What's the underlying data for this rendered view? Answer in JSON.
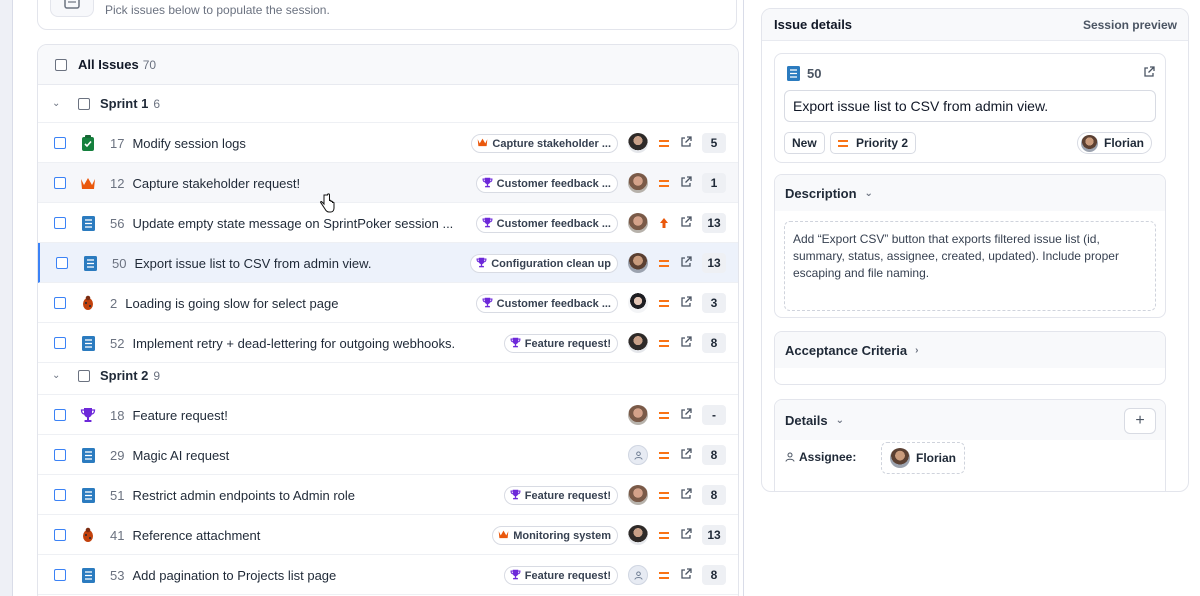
{
  "hint": {
    "text": "Pick issues below to populate the session."
  },
  "issues": {
    "all_label": "All Issues",
    "all_count": "70",
    "sprints": [
      {
        "label": "Sprint 1",
        "count": "6"
      },
      {
        "label": "Sprint 2",
        "count": "9"
      }
    ],
    "rows": [
      {
        "id": "17",
        "title": "Modify session logs",
        "type": "task-done",
        "epic": "Capture stakeholder ...",
        "epic_icon": "crown-icon",
        "avatar": "f3",
        "priority": "medium",
        "points": "5"
      },
      {
        "id": "12",
        "title": "Capture stakeholder request!",
        "type": "crown",
        "epic": "Customer feedback ...",
        "epic_icon": "trophy-icon",
        "avatar": "f2",
        "priority": "medium",
        "points": "1"
      },
      {
        "id": "56",
        "title": "Update empty state message on SprintPoker session ...",
        "type": "story",
        "epic": "Customer feedback ...",
        "epic_icon": "trophy-icon",
        "avatar": "f2",
        "priority": "high",
        "points": "13"
      },
      {
        "id": "50",
        "title": "Export issue list to CSV from admin view.",
        "type": "story",
        "epic": "Configuration clean up",
        "epic_icon": "trophy-icon",
        "avatar": "f1",
        "priority": "medium",
        "points": "13"
      },
      {
        "id": "2",
        "title": "Loading is going slow for select page",
        "type": "bug",
        "epic": "Customer feedback ...",
        "epic_icon": "trophy-icon",
        "avatar": "f4",
        "priority": "medium",
        "points": "3"
      },
      {
        "id": "52",
        "title": "Implement retry + dead-lettering for outgoing webhooks.",
        "type": "story",
        "epic": "Feature request!",
        "epic_icon": "trophy-icon",
        "avatar": "f3",
        "priority": "medium",
        "points": "8"
      },
      {
        "id": "18",
        "title": "Feature request!",
        "type": "trophy",
        "epic": "",
        "epic_icon": "",
        "avatar": "f2",
        "priority": "medium",
        "points": "-"
      },
      {
        "id": "29",
        "title": "Magic AI request",
        "type": "story",
        "epic": "",
        "epic_icon": "",
        "avatar": "empty",
        "priority": "medium",
        "points": "8"
      },
      {
        "id": "51",
        "title": "Restrict admin endpoints to Admin role",
        "type": "story",
        "epic": "Feature request!",
        "epic_icon": "trophy-icon",
        "avatar": "f2",
        "priority": "medium",
        "points": "8"
      },
      {
        "id": "41",
        "title": "Reference attachment",
        "type": "bug",
        "epic": "Monitoring system",
        "epic_icon": "crown-icon",
        "avatar": "f3",
        "priority": "medium",
        "points": "13"
      },
      {
        "id": "53",
        "title": "Add pagination to Projects list page",
        "type": "story",
        "epic": "Feature request!",
        "epic_icon": "trophy-icon",
        "avatar": "empty",
        "priority": "medium",
        "points": "8"
      }
    ]
  },
  "details": {
    "title": "Issue details",
    "preview": "Session preview",
    "issue_id": "50",
    "summary": "Export issue list to CSV from admin view.",
    "status": "New",
    "priority": "Priority 2",
    "assignee": "Florian",
    "description_label": "Description",
    "description": "Add “Export CSV” button that exports filtered issue list (id, summary, status, assignee, created, updated). Include proper escaping and file naming.",
    "acceptance_label": "Acceptance Criteria",
    "details_label": "Details",
    "assignee_label": "Assignee:",
    "plus": "+"
  },
  "colors": {
    "accent": "#3b82f6",
    "priority": "#f97316",
    "story": "#2b7bbf",
    "bug": "#c2410c",
    "trophy": "#6d28d9",
    "crown": "#ea580c",
    "done": "#15803d"
  }
}
